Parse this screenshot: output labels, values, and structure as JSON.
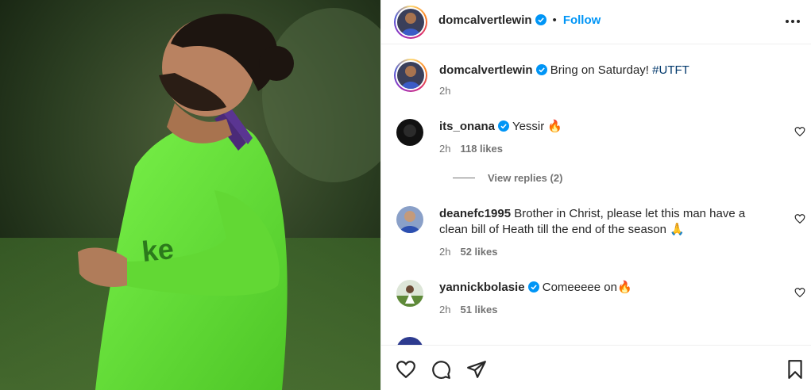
{
  "post": {
    "username": "domcalvertlewin",
    "follow_label": "Follow",
    "separator": "•"
  },
  "caption": {
    "username": "domcalvertlewin",
    "text": "Bring on Saturday! ",
    "hashtag": "#UTFT",
    "time": "2h"
  },
  "comments": [
    {
      "username": "its_onana",
      "verified": true,
      "text": "Yessir 🔥",
      "time": "2h",
      "likes": "118 likes"
    },
    {
      "username": "deanefc1995",
      "verified": false,
      "text": "Brother in Christ, please let this man have a clean bill of Heath till the end of the season 🙏",
      "time": "2h",
      "likes": "52 likes"
    },
    {
      "username": "yannickbolasie",
      "verified": true,
      "text": "Comeeeee on🔥",
      "time": "2h",
      "likes": "51 likes"
    }
  ],
  "view_replies_label": "View replies (2)",
  "colors": {
    "accent": "#0095f6",
    "verified": "#0095f6",
    "jersey": "#6be03a"
  },
  "icons": [
    "verified-icon",
    "more-icon",
    "heart-icon",
    "comment-icon",
    "share-icon",
    "bookmark-icon"
  ]
}
